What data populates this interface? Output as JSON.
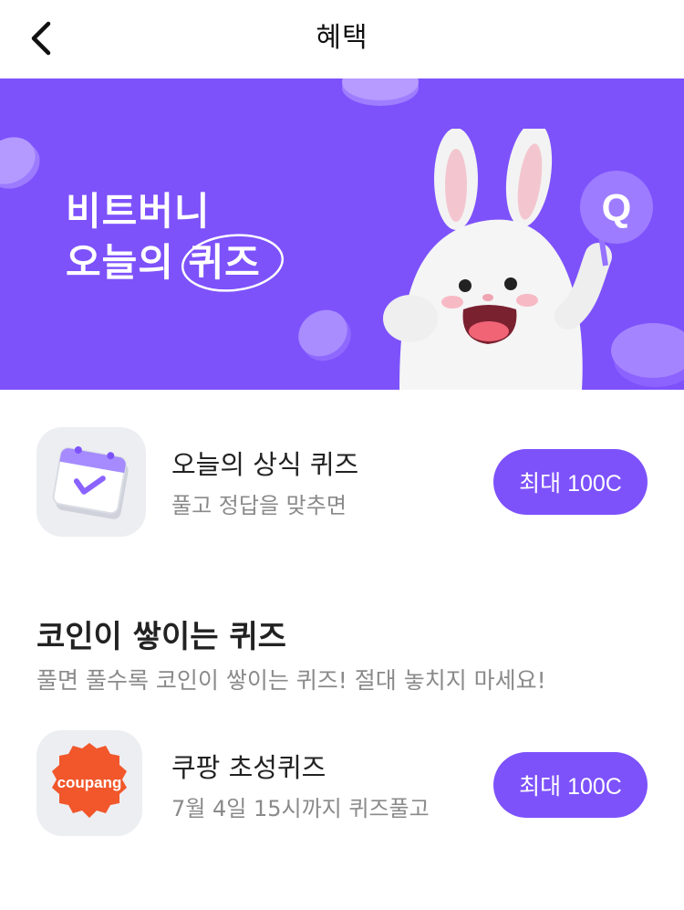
{
  "header": {
    "title": "혜택"
  },
  "banner": {
    "title_line1": "비트버니",
    "title_line2_prefix": "오늘의 ",
    "title_line2_highlight": "퀴즈",
    "quiz_badge": "Q",
    "background_color": "#7d52fb"
  },
  "daily_quiz": {
    "icon": "calendar-check-icon",
    "title": "오늘의 상식 퀴즈",
    "subtitle": "풀고 정답을 맞추면",
    "button_label": "최대 100C"
  },
  "accumulate_section": {
    "title": "코인이 쌓이는 퀴즈",
    "subtitle": "풀면 풀수록 코인이 쌓이는 퀴즈! 절대 놓치지 마세요!",
    "items": [
      {
        "logo_text": "coupang",
        "title": "쿠팡 초성퀴즈",
        "subtitle": "7월 4일 15시까지 퀴즈풀고",
        "button_label": "최대 100C"
      }
    ]
  },
  "colors": {
    "accent": "#7d52fb",
    "coupang": "#f1572b"
  }
}
